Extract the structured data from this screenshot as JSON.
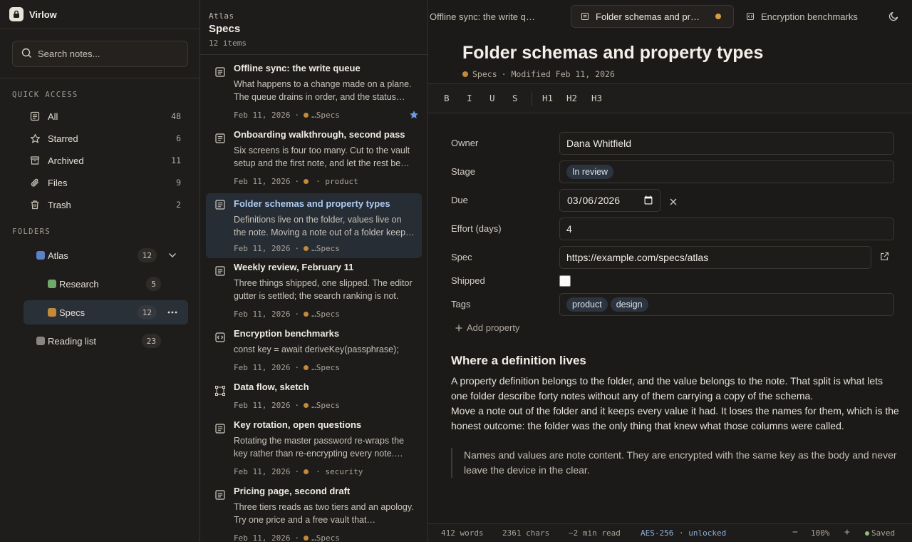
{
  "app": {
    "name": "Virlow"
  },
  "sidebar": {
    "search_placeholder": "Search notes...",
    "quick_access_label": "QUICK ACCESS",
    "quick_access": [
      {
        "label": "All",
        "count": "48",
        "icon": "all-notes-icon"
      },
      {
        "label": "Starred",
        "count": "6",
        "icon": "star-icon"
      },
      {
        "label": "Archived",
        "count": "11",
        "icon": "archive-icon"
      },
      {
        "label": "Files",
        "count": "9",
        "icon": "paperclip-icon"
      },
      {
        "label": "Trash",
        "count": "2",
        "icon": "trash-icon"
      }
    ],
    "folders_label": "FOLDERS",
    "folders": [
      {
        "label": "Atlas",
        "count": "12",
        "color": "#5b82c9"
      },
      {
        "label": "Research",
        "count": "5",
        "color": "#6fa86a"
      },
      {
        "label": "Specs",
        "count": "12",
        "color": "#c48a3a"
      },
      {
        "label": "Reading list",
        "count": "23",
        "color": "#8a8580"
      }
    ]
  },
  "notelist": {
    "crumb": "Atlas",
    "title": "Specs",
    "count": "12 items",
    "notes": [
      {
        "title": "Offline sync: the write queue",
        "snippet": "What happens to a change made on a plane. The queue drains in order, and the status…",
        "date": "Feb 11, 2026",
        "sep": "·",
        "folder": "…Specs",
        "icon": "note-icon"
      },
      {
        "title": "Onboarding walkthrough, second pass",
        "snippet": "Six screens is four too many. Cut to the vault setup and the first note, and let the rest be…",
        "date": "Feb 11, 2026",
        "sep": "·",
        "folder": "· product",
        "icon": "note-icon"
      },
      {
        "title": "Folder schemas and property types",
        "snippet": "Definitions live on the folder, values live on the note. Moving a note out of a folder keep…",
        "date": "Feb 11, 2026",
        "sep": "·",
        "folder": "…Specs",
        "icon": "note-icon"
      },
      {
        "title": "Weekly review, February 11",
        "snippet": "Three things shipped, one slipped. The editor gutter is settled; the search ranking is not.",
        "date": "Feb 11, 2026",
        "sep": "·",
        "folder": "…Specs",
        "icon": "note-icon"
      },
      {
        "title": "Encryption benchmarks",
        "snippet": "const key = await deriveKey(passphrase);",
        "date": "Feb 11, 2026",
        "sep": "·",
        "folder": "…Specs",
        "icon": "code-icon"
      },
      {
        "title": "Data flow, sketch",
        "snippet": "",
        "date": "Feb 11, 2026",
        "sep": "·",
        "folder": "…Specs",
        "icon": "diagram-icon"
      },
      {
        "title": "Key rotation, open questions",
        "snippet": "Rotating the master password re-wraps the key rather than re-encrypting every note.…",
        "date": "Feb 11, 2026",
        "sep": "·",
        "folder": "· security",
        "icon": "note-icon"
      },
      {
        "title": "Pricing page, second draft",
        "snippet": "Three tiers reads as two tiers and an apology. Try one price and a free vault that…",
        "date": "Feb 11, 2026",
        "sep": "·",
        "folder": "…Specs",
        "icon": "note-icon"
      }
    ]
  },
  "tabs": [
    {
      "label": "Offline sync: the write q…",
      "active": false
    },
    {
      "label": "Folder schemas and pr…",
      "active": true,
      "unsaved": true
    },
    {
      "label": "Encryption benchmarks",
      "active": false
    }
  ],
  "doc": {
    "title": "Folder schemas and property types",
    "folder": "Specs",
    "modified": "· Modified Feb 11, 2026",
    "toolbar": [
      "B",
      "I",
      "U",
      "S",
      "H1",
      "H2",
      "H3"
    ],
    "props": {
      "owner_label": "Owner",
      "owner": "Dana Whitfield",
      "stage_label": "Stage",
      "stage": "In review",
      "due_label": "Due",
      "due": "2026-03-06",
      "effort_label": "Effort (days)",
      "effort": "4",
      "spec_label": "Spec",
      "spec": "https://example.com/specs/atlas",
      "shipped_label": "Shipped",
      "tags_label": "Tags",
      "tags": [
        "product",
        "design"
      ],
      "add_label": "Add property"
    },
    "heading": "Where a definition lives",
    "para1": "A property definition belongs to the folder, and the value belongs to the note. That split is what lets one folder describe forty notes without any of them carrying a copy of the schema.",
    "para2": "Move a note out of the folder and it keeps every value it had. It loses the names for them, which is the honest outcome: the folder was the only thing that knew what those columns were called.",
    "quote": "Names and values are note content. They are encrypted with the same key as the body and never leave the device in the clear."
  },
  "status": {
    "words": "412 words",
    "chars": "2361 chars",
    "read": "~2 min read",
    "cipher": "AES-256",
    "lock": "· unlocked",
    "zoom_out": "−",
    "zoom": "100%",
    "zoom_in": "+",
    "saved": "Saved"
  },
  "colors": {
    "accent": "#5b82c9",
    "specs": "#c48a3a",
    "star": "#6e9ae0",
    "saved": "#8fbf7a"
  }
}
